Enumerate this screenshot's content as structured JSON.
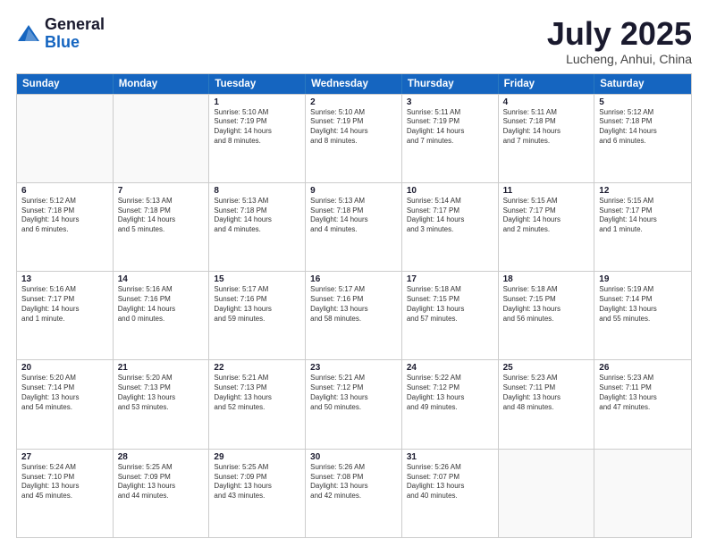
{
  "header": {
    "logo_general": "General",
    "logo_blue": "Blue",
    "month": "July 2025",
    "location": "Lucheng, Anhui, China"
  },
  "days_of_week": [
    "Sunday",
    "Monday",
    "Tuesday",
    "Wednesday",
    "Thursday",
    "Friday",
    "Saturday"
  ],
  "rows": [
    [
      {
        "day": "",
        "info": ""
      },
      {
        "day": "",
        "info": ""
      },
      {
        "day": "1",
        "info": "Sunrise: 5:10 AM\nSunset: 7:19 PM\nDaylight: 14 hours\nand 8 minutes."
      },
      {
        "day": "2",
        "info": "Sunrise: 5:10 AM\nSunset: 7:19 PM\nDaylight: 14 hours\nand 8 minutes."
      },
      {
        "day": "3",
        "info": "Sunrise: 5:11 AM\nSunset: 7:19 PM\nDaylight: 14 hours\nand 7 minutes."
      },
      {
        "day": "4",
        "info": "Sunrise: 5:11 AM\nSunset: 7:18 PM\nDaylight: 14 hours\nand 7 minutes."
      },
      {
        "day": "5",
        "info": "Sunrise: 5:12 AM\nSunset: 7:18 PM\nDaylight: 14 hours\nand 6 minutes."
      }
    ],
    [
      {
        "day": "6",
        "info": "Sunrise: 5:12 AM\nSunset: 7:18 PM\nDaylight: 14 hours\nand 6 minutes."
      },
      {
        "day": "7",
        "info": "Sunrise: 5:13 AM\nSunset: 7:18 PM\nDaylight: 14 hours\nand 5 minutes."
      },
      {
        "day": "8",
        "info": "Sunrise: 5:13 AM\nSunset: 7:18 PM\nDaylight: 14 hours\nand 4 minutes."
      },
      {
        "day": "9",
        "info": "Sunrise: 5:13 AM\nSunset: 7:18 PM\nDaylight: 14 hours\nand 4 minutes."
      },
      {
        "day": "10",
        "info": "Sunrise: 5:14 AM\nSunset: 7:17 PM\nDaylight: 14 hours\nand 3 minutes."
      },
      {
        "day": "11",
        "info": "Sunrise: 5:15 AM\nSunset: 7:17 PM\nDaylight: 14 hours\nand 2 minutes."
      },
      {
        "day": "12",
        "info": "Sunrise: 5:15 AM\nSunset: 7:17 PM\nDaylight: 14 hours\nand 1 minute."
      }
    ],
    [
      {
        "day": "13",
        "info": "Sunrise: 5:16 AM\nSunset: 7:17 PM\nDaylight: 14 hours\nand 1 minute."
      },
      {
        "day": "14",
        "info": "Sunrise: 5:16 AM\nSunset: 7:16 PM\nDaylight: 14 hours\nand 0 minutes."
      },
      {
        "day": "15",
        "info": "Sunrise: 5:17 AM\nSunset: 7:16 PM\nDaylight: 13 hours\nand 59 minutes."
      },
      {
        "day": "16",
        "info": "Sunrise: 5:17 AM\nSunset: 7:16 PM\nDaylight: 13 hours\nand 58 minutes."
      },
      {
        "day": "17",
        "info": "Sunrise: 5:18 AM\nSunset: 7:15 PM\nDaylight: 13 hours\nand 57 minutes."
      },
      {
        "day": "18",
        "info": "Sunrise: 5:18 AM\nSunset: 7:15 PM\nDaylight: 13 hours\nand 56 minutes."
      },
      {
        "day": "19",
        "info": "Sunrise: 5:19 AM\nSunset: 7:14 PM\nDaylight: 13 hours\nand 55 minutes."
      }
    ],
    [
      {
        "day": "20",
        "info": "Sunrise: 5:20 AM\nSunset: 7:14 PM\nDaylight: 13 hours\nand 54 minutes."
      },
      {
        "day": "21",
        "info": "Sunrise: 5:20 AM\nSunset: 7:13 PM\nDaylight: 13 hours\nand 53 minutes."
      },
      {
        "day": "22",
        "info": "Sunrise: 5:21 AM\nSunset: 7:13 PM\nDaylight: 13 hours\nand 52 minutes."
      },
      {
        "day": "23",
        "info": "Sunrise: 5:21 AM\nSunset: 7:12 PM\nDaylight: 13 hours\nand 50 minutes."
      },
      {
        "day": "24",
        "info": "Sunrise: 5:22 AM\nSunset: 7:12 PM\nDaylight: 13 hours\nand 49 minutes."
      },
      {
        "day": "25",
        "info": "Sunrise: 5:23 AM\nSunset: 7:11 PM\nDaylight: 13 hours\nand 48 minutes."
      },
      {
        "day": "26",
        "info": "Sunrise: 5:23 AM\nSunset: 7:11 PM\nDaylight: 13 hours\nand 47 minutes."
      }
    ],
    [
      {
        "day": "27",
        "info": "Sunrise: 5:24 AM\nSunset: 7:10 PM\nDaylight: 13 hours\nand 45 minutes."
      },
      {
        "day": "28",
        "info": "Sunrise: 5:25 AM\nSunset: 7:09 PM\nDaylight: 13 hours\nand 44 minutes."
      },
      {
        "day": "29",
        "info": "Sunrise: 5:25 AM\nSunset: 7:09 PM\nDaylight: 13 hours\nand 43 minutes."
      },
      {
        "day": "30",
        "info": "Sunrise: 5:26 AM\nSunset: 7:08 PM\nDaylight: 13 hours\nand 42 minutes."
      },
      {
        "day": "31",
        "info": "Sunrise: 5:26 AM\nSunset: 7:07 PM\nDaylight: 13 hours\nand 40 minutes."
      },
      {
        "day": "",
        "info": ""
      },
      {
        "day": "",
        "info": ""
      }
    ]
  ]
}
